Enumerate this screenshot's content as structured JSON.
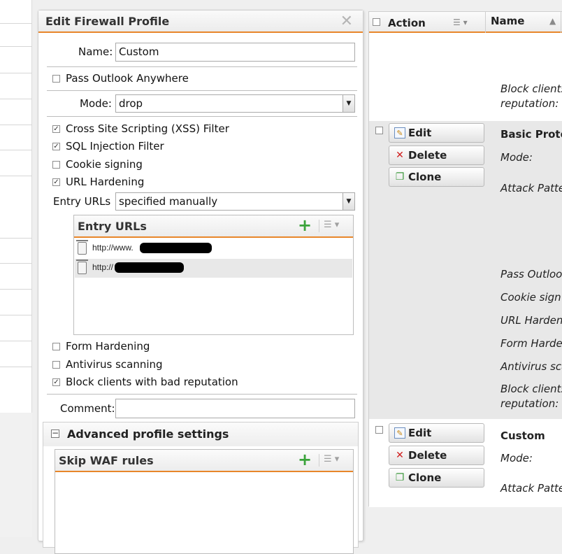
{
  "dialog": {
    "title": "Edit Firewall Profile",
    "close_icon": "close-icon",
    "name_label": "Name:",
    "name_value": "Custom",
    "pass_outlook_label": "Pass Outlook Anywhere",
    "mode_label": "Mode:",
    "mode_value": "drop",
    "filters": [
      {
        "label": "Cross Site Scripting (XSS) Filter",
        "checked": true
      },
      {
        "label": "SQL Injection Filter",
        "checked": true
      },
      {
        "label": "Cookie signing",
        "checked": false
      },
      {
        "label": "URL Hardening",
        "checked": true
      }
    ],
    "entry_urls_label": "Entry URLs",
    "entry_urls_value": "specified manually",
    "entry_urls_grid": {
      "title": "Entry URLs",
      "rows": [
        "http://www.",
        "http://"
      ]
    },
    "extra_options": [
      {
        "label": "Form Hardening",
        "checked": false
      },
      {
        "label": "Antivirus scanning",
        "checked": false
      },
      {
        "label": "Block clients with bad reputation",
        "checked": true
      }
    ],
    "comment_label": "Comment:",
    "comment_value": "",
    "advanced": {
      "title": "Advanced profile settings",
      "skip_waf_title": "Skip WAF rules"
    }
  },
  "list": {
    "headers": {
      "action": "Action",
      "name": "Name"
    },
    "row0": {
      "reputation_line1": "Block clients",
      "reputation_line2": "reputation:"
    },
    "row1": {
      "name": "Basic Prote",
      "buttons": {
        "edit": "Edit",
        "delete": "Delete",
        "clone": "Clone"
      },
      "fields": [
        "Mode:",
        "Attack Patte",
        "Pass Outloo",
        "Cookie sign",
        "URL Harden",
        "Form Harde",
        "Antivirus sca"
      ],
      "reputation_line1": "Block clients",
      "reputation_line2": "reputation:"
    },
    "row2": {
      "name": "Custom",
      "buttons": {
        "edit": "Edit",
        "delete": "Delete",
        "clone": "Clone"
      },
      "fields": [
        "Mode:",
        "Attack Patte"
      ]
    }
  },
  "colors": {
    "accent": "#e8862a",
    "add_green": "#3aa33a",
    "delete_red": "#d01e1e",
    "row_alt": "#e8e8e8"
  }
}
